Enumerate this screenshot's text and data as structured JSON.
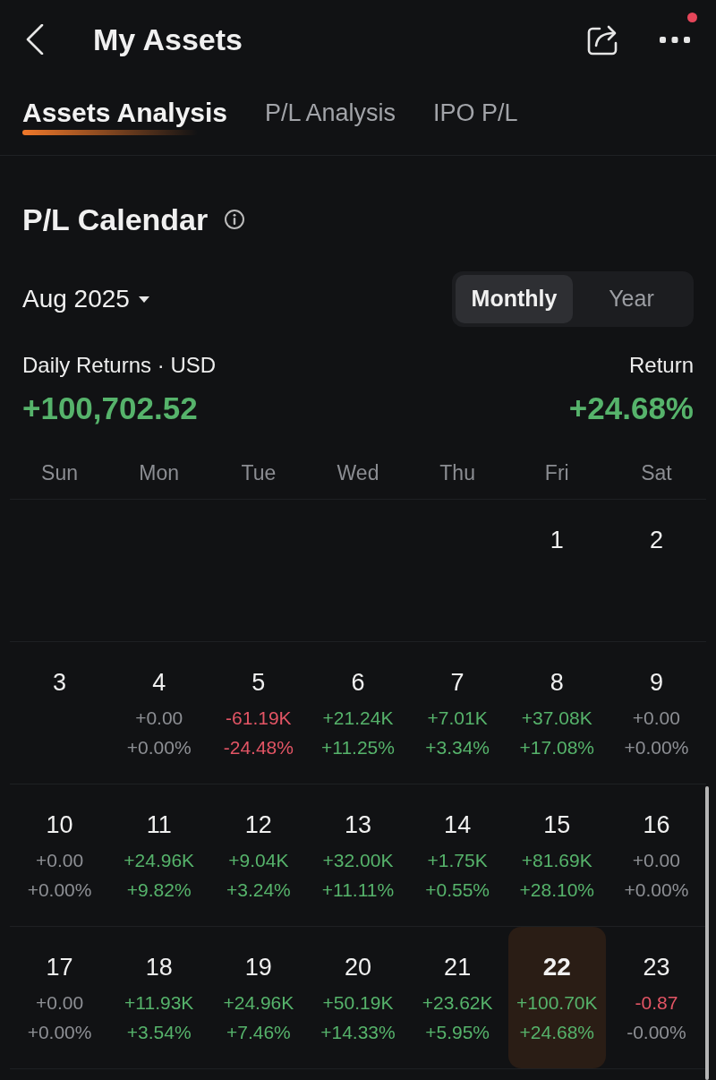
{
  "header": {
    "title": "My Assets",
    "has_notification": true
  },
  "tabs": [
    {
      "label": "Assets Analysis",
      "selected": true
    },
    {
      "label": "P/L Analysis",
      "selected": false
    },
    {
      "label": "IPO P/L",
      "selected": false
    }
  ],
  "calendar": {
    "title": "P/L Calendar",
    "month": "Aug 2025",
    "period_options": [
      {
        "label": "Monthly",
        "selected": true
      },
      {
        "label": "Year",
        "selected": false
      }
    ],
    "total": {
      "label": "Daily Returns · USD",
      "value": "+100,702.52",
      "color": "#56b36b"
    },
    "return": {
      "label": "Return",
      "value": "+24.68%",
      "color": "#56b36b"
    },
    "weekdays": [
      "Sun",
      "Mon",
      "Tue",
      "Wed",
      "Thu",
      "Fri",
      "Sat"
    ],
    "weeks": [
      [
        {
          "day": "1",
          "selected": false
        },
        {
          "day": "2",
          "selected": false
        }
      ],
      [
        {
          "day": "3",
          "selected": false
        },
        {
          "day": "4",
          "amount": {
            "text": "+0.00",
            "color": "#8d8f94"
          },
          "percent": {
            "text": "+0.00%",
            "color": "#8d8f94"
          },
          "selected": false
        },
        {
          "day": "5",
          "amount": {
            "text": "-61.19K",
            "color": "#e35565"
          },
          "percent": {
            "text": "-24.48%",
            "color": "#e35565"
          },
          "selected": false
        },
        {
          "day": "6",
          "amount": {
            "text": "+21.24K",
            "color": "#56b36b"
          },
          "percent": {
            "text": "+11.25%",
            "color": "#56b36b"
          },
          "selected": false
        },
        {
          "day": "7",
          "amount": {
            "text": "+7.01K",
            "color": "#56b36b"
          },
          "percent": {
            "text": "+3.34%",
            "color": "#56b36b"
          },
          "selected": false
        },
        {
          "day": "8",
          "amount": {
            "text": "+37.08K",
            "color": "#56b36b"
          },
          "percent": {
            "text": "+17.08%",
            "color": "#56b36b"
          },
          "selected": false
        },
        {
          "day": "9",
          "amount": {
            "text": "+0.00",
            "color": "#8d8f94"
          },
          "percent": {
            "text": "+0.00%",
            "color": "#8d8f94"
          },
          "selected": false
        }
      ],
      [
        {
          "day": "10",
          "amount": {
            "text": "+0.00",
            "color": "#8d8f94"
          },
          "percent": {
            "text": "+0.00%",
            "color": "#8d8f94"
          },
          "selected": false
        },
        {
          "day": "11",
          "amount": {
            "text": "+24.96K",
            "color": "#56b36b"
          },
          "percent": {
            "text": "+9.82%",
            "color": "#56b36b"
          },
          "selected": false
        },
        {
          "day": "12",
          "amount": {
            "text": "+9.04K",
            "color": "#56b36b"
          },
          "percent": {
            "text": "+3.24%",
            "color": "#56b36b"
          },
          "selected": false
        },
        {
          "day": "13",
          "amount": {
            "text": "+32.00K",
            "color": "#56b36b"
          },
          "percent": {
            "text": "+11.11%",
            "color": "#56b36b"
          },
          "selected": false
        },
        {
          "day": "14",
          "amount": {
            "text": "+1.75K",
            "color": "#56b36b"
          },
          "percent": {
            "text": "+0.55%",
            "color": "#56b36b"
          },
          "selected": false
        },
        {
          "day": "15",
          "amount": {
            "text": "+81.69K",
            "color": "#56b36b"
          },
          "percent": {
            "text": "+28.10%",
            "color": "#56b36b"
          },
          "selected": false
        },
        {
          "day": "16",
          "amount": {
            "text": "+0.00",
            "color": "#8d8f94"
          },
          "percent": {
            "text": "+0.00%",
            "color": "#8d8f94"
          },
          "selected": false
        }
      ],
      [
        {
          "day": "17",
          "amount": {
            "text": "+0.00",
            "color": "#8d8f94"
          },
          "percent": {
            "text": "+0.00%",
            "color": "#8d8f94"
          },
          "selected": false
        },
        {
          "day": "18",
          "amount": {
            "text": "+11.93K",
            "color": "#56b36b"
          },
          "percent": {
            "text": "+3.54%",
            "color": "#56b36b"
          },
          "selected": false
        },
        {
          "day": "19",
          "amount": {
            "text": "+24.96K",
            "color": "#56b36b"
          },
          "percent": {
            "text": "+7.46%",
            "color": "#56b36b"
          },
          "selected": false
        },
        {
          "day": "20",
          "amount": {
            "text": "+50.19K",
            "color": "#56b36b"
          },
          "percent": {
            "text": "+14.33%",
            "color": "#56b36b"
          },
          "selected": false
        },
        {
          "day": "21",
          "amount": {
            "text": "+23.62K",
            "color": "#56b36b"
          },
          "percent": {
            "text": "+5.95%",
            "color": "#56b36b"
          },
          "selected": false
        },
        {
          "day": "22",
          "amount": {
            "text": "+100.70K",
            "color": "#56b36b"
          },
          "percent": {
            "text": "+24.68%",
            "color": "#56b36b"
          },
          "selected": true
        },
        {
          "day": "23",
          "amount": {
            "text": "-0.87",
            "color": "#e35565"
          },
          "percent": {
            "text": "-0.00%",
            "color": "#8d8f94"
          },
          "selected": false
        }
      ]
    ]
  }
}
